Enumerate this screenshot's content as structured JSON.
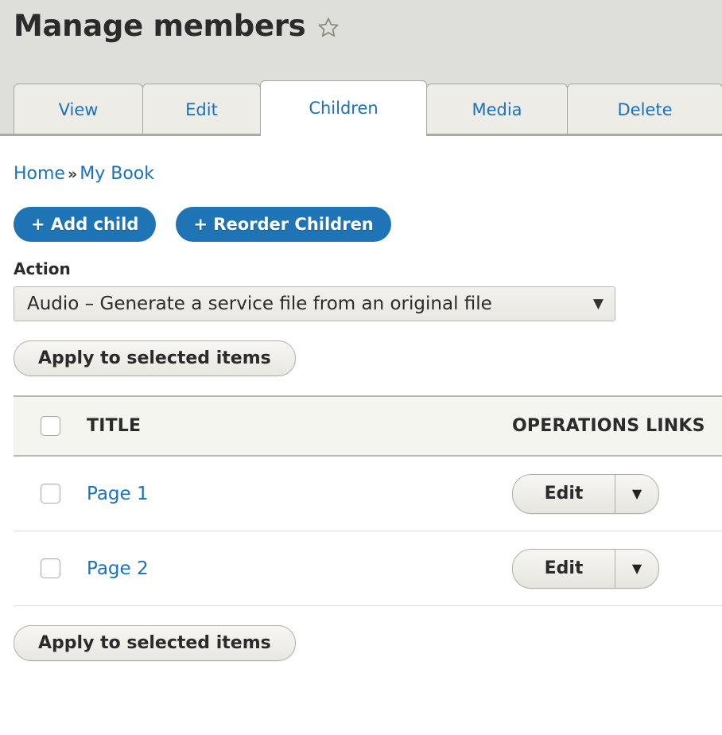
{
  "header": {
    "title": "Manage members",
    "star_icon": "star-outline-icon"
  },
  "tabs": [
    {
      "label": "View",
      "active": false
    },
    {
      "label": "Edit",
      "active": false
    },
    {
      "label": "Children",
      "active": true
    },
    {
      "label": "Media",
      "active": false
    },
    {
      "label": "Delete",
      "active": false
    }
  ],
  "breadcrumb": {
    "items": [
      "Home",
      "My Book"
    ],
    "separator": "»"
  },
  "action_buttons": {
    "add_child": "+ Add child",
    "reorder_children": "+ Reorder Children"
  },
  "action_form": {
    "label": "Action",
    "select_value": "Audio – Generate a service file from an original file",
    "select_arrow": "▼",
    "apply_top": "Apply to selected items",
    "apply_bottom": "Apply to selected items"
  },
  "table": {
    "columns": [
      "TITLE",
      "OPERATIONS LINKS"
    ],
    "rows": [
      {
        "title": "Page 1",
        "op_label": "Edit",
        "op_arrow": "▼"
      },
      {
        "title": "Page 2",
        "op_label": "Edit",
        "op_arrow": "▼"
      }
    ]
  },
  "colors": {
    "header_band": "#dededa",
    "tab_inactive": "#edece7",
    "tab_active": "#ffffff",
    "link_blue": "#1a72ba",
    "primary_blue": "#1f74b5",
    "table_head_bg": "#f5f5f0",
    "border_gray": "#a9a9a5"
  }
}
